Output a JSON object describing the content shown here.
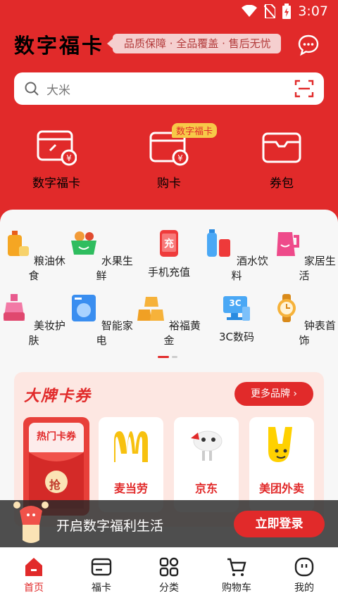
{
  "status": {
    "time": "3:07"
  },
  "header": {
    "brand": "数字福卡",
    "slogan": "品质保障 · 全品覆盖 · 售后无忧"
  },
  "search": {
    "placeholder": "大米"
  },
  "quick": [
    {
      "label": "数字福卡",
      "icon": "card-link-icon"
    },
    {
      "label": "购卡",
      "icon": "card-yuan-icon",
      "tag": "数字福卡"
    },
    {
      "label": "券包",
      "icon": "wallet-icon"
    }
  ],
  "categories": [
    {
      "label": "粮油休食",
      "icon": "oil-bottle-icon"
    },
    {
      "label": "水果生鲜",
      "icon": "fruit-basket-icon"
    },
    {
      "label": "手机充值",
      "icon": "phone-recharge-icon",
      "glyph": "充"
    },
    {
      "label": "酒水饮料",
      "icon": "drinks-icon"
    },
    {
      "label": "家居生活",
      "icon": "kettle-icon"
    },
    {
      "label": "美妆护肤",
      "icon": "cosmetics-icon"
    },
    {
      "label": "智能家电",
      "icon": "washing-machine-icon"
    },
    {
      "label": "裕福黄金",
      "icon": "gold-bars-icon"
    },
    {
      "label": "3C数码",
      "icon": "computer-icon",
      "glyph": "3C"
    },
    {
      "label": "钟表首饰",
      "icon": "watch-icon"
    }
  ],
  "brands": {
    "title": "大牌卡券",
    "more": "更多品牌",
    "hot": "热门卡券",
    "hot_coin": "抢",
    "cards": [
      {
        "name": "麦当劳",
        "icon": "mcdonalds-logo-icon"
      },
      {
        "name": "京东",
        "icon": "jd-dog-icon"
      },
      {
        "name": "美团外卖",
        "icon": "meituan-kangaroo-icon"
      }
    ]
  },
  "login": {
    "text": "开启数字福利生活",
    "button": "立即登录"
  },
  "nav": [
    {
      "label": "首页",
      "icon": "home-icon",
      "active": true
    },
    {
      "label": "福卡",
      "icon": "card-icon"
    },
    {
      "label": "分类",
      "icon": "grid-icon"
    },
    {
      "label": "购物车",
      "icon": "cart-icon"
    },
    {
      "label": "我的",
      "icon": "profile-icon"
    }
  ],
  "colors": {
    "primary": "#e12a2a",
    "active_nav": "#e12a2a",
    "slogan_bg": "#f5cfcf"
  }
}
